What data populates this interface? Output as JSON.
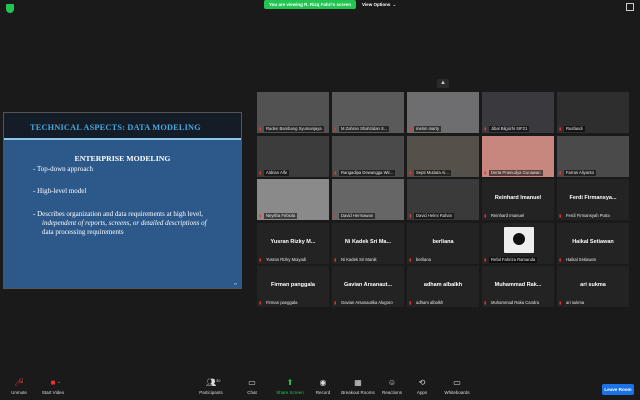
{
  "top": {
    "banner": "You are viewing R. Rizq Fahri's screen",
    "view_options": "View Options",
    "view_chevron": "⌄"
  },
  "slide": {
    "title": "TECHNICAL ASPECTS: DATA MODELING",
    "heading": "ENTERPRISE MODELING",
    "bullets": [
      "- Top-down approach",
      "- High-level model",
      "- Describes organization and data requirements at high level,",
      "independent of reports, screens, or detailed descriptions of",
      "data processing requirements"
    ]
  },
  "tiles": [
    {
      "name": "Raden Bambang Syumanjaya",
      "big": "",
      "bg": "#525252"
    },
    {
      "name": "M Zahran Shahzidan S...",
      "big": "",
      "bg": "#5a5a5a"
    },
    {
      "name": "melon marty",
      "big": "",
      "bg": "#6e6e70"
    },
    {
      "name": "Jibal Bilgiizhi SIF21",
      "big": "",
      "bg": "#3a3a3e"
    },
    {
      "name": "Rusfandi",
      "big": "",
      "bg": "#2e2e2e"
    },
    {
      "name": "Aldrian Alfe",
      "big": "",
      "bg": "#3c3c3c"
    },
    {
      "name": "Rangadipa Dewangga Wir...",
      "big": "",
      "bg": "#4a4a4a"
    },
    {
      "name": "Septi Mutiara Ai...",
      "big": "",
      "bg": "#56504a"
    },
    {
      "name": "Derta Pramudya Gunawan",
      "big": "",
      "bg": "#c8877e"
    },
    {
      "name": "Farras Aliyanto",
      "big": "",
      "bg": "#4a4a4a"
    },
    {
      "name": "Neysha Febiola",
      "big": "",
      "bg": "#8a8a8a"
    },
    {
      "name": "David Hermawan",
      "big": "",
      "bg": "#666"
    },
    {
      "name": "David Helmi Rahan",
      "big": "",
      "bg": "#3a3a3a"
    },
    {
      "name": "Reinhard Imanuel",
      "big": "Reinhard Imanuel",
      "bg": "#232323"
    },
    {
      "name": "Ferdi Firmansyah Putra",
      "big": "Ferdi Firmansya...",
      "bg": "#232323"
    },
    {
      "name": "Yusran Rizky Muiyadi",
      "big": "Yusran Rizky M...",
      "bg": "#232323"
    },
    {
      "name": "Ni Kadek Sri Manik",
      "big": "Ni Kadek Sri Ma...",
      "bg": "#232323"
    },
    {
      "name": "berliana",
      "big": "berliana",
      "bg": "#232323"
    },
    {
      "name": "Refal Fahriza Ramanda",
      "big": "",
      "bg": "#232323"
    },
    {
      "name": "Haikal Setiawan",
      "big": "Haikal Setiawan",
      "bg": "#232323"
    },
    {
      "name": "Firman panggala",
      "big": "Firman panggala",
      "bg": "#232323"
    },
    {
      "name": "Gavian Arsanautika Alugoro",
      "big": "Gavian Arsanaut...",
      "bg": "#232323"
    },
    {
      "name": "adham albalkh",
      "big": "adham albalkh",
      "bg": "#232323"
    },
    {
      "name": "Muhammad Raka Candra",
      "big": "Muhammad Rak...",
      "bg": "#232323"
    },
    {
      "name": "ari sukma",
      "big": "ari sukma",
      "bg": "#232323"
    }
  ],
  "toolbar": {
    "unmute": "Unmute",
    "start_video": "Start Video",
    "participants": "Participants",
    "participants_count": "30",
    "chat": "Chat",
    "share_screen": "Share Screen",
    "record": "Record",
    "breakout_rooms": "Breakout Rooms",
    "reactions": "Reactions",
    "apps": "Apps",
    "whiteboards": "Whiteboards",
    "leave": "Leave Room"
  },
  "colors": {
    "green": "#23c552",
    "leave_blue": "#1a73e8",
    "slide_blue": "#2c588a"
  }
}
